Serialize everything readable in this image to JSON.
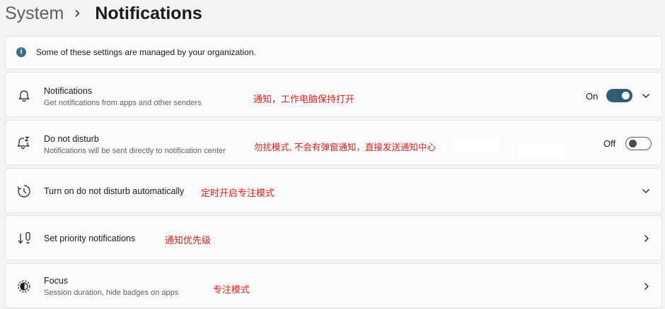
{
  "breadcrumb": {
    "parent": "System",
    "current": "Notifications"
  },
  "info": {
    "icon": "info-icon",
    "text": "Some of these settings are managed by your organization."
  },
  "rows": [
    {
      "icon": "bell-icon",
      "title": "Notifications",
      "description": "Get notifications from apps and other senders",
      "annotation": "通知，工作电脑保持打开",
      "toggle_state": "On",
      "control": "toggle-and-chevron-down"
    },
    {
      "icon": "do-not-disturb-bell-icon",
      "title": "Do not disturb",
      "description": "Notifications will be sent directly to notification center",
      "annotation": "勿扰模式, 不会有弹窗通知，直接发送通知中心",
      "toggle_state": "Off",
      "control": "toggle"
    },
    {
      "icon": "clock-icon",
      "title": "Turn on do not disturb automatically",
      "annotation": "定时开启专注模式",
      "control": "chevron-down"
    },
    {
      "icon": "priority-icon",
      "title": "Set priority notifications",
      "annotation": "通知优先级",
      "control": "chevron-right"
    },
    {
      "icon": "focus-icon",
      "title": "Focus",
      "description": "Session duration, hide badges on apps",
      "annotation": "专注模式",
      "control": "chevron-right"
    }
  ],
  "colors": {
    "accent": "#2f5d75",
    "annotation": "#e01e1e",
    "background": "#f3f3f3",
    "card": "#fbfbfb"
  }
}
